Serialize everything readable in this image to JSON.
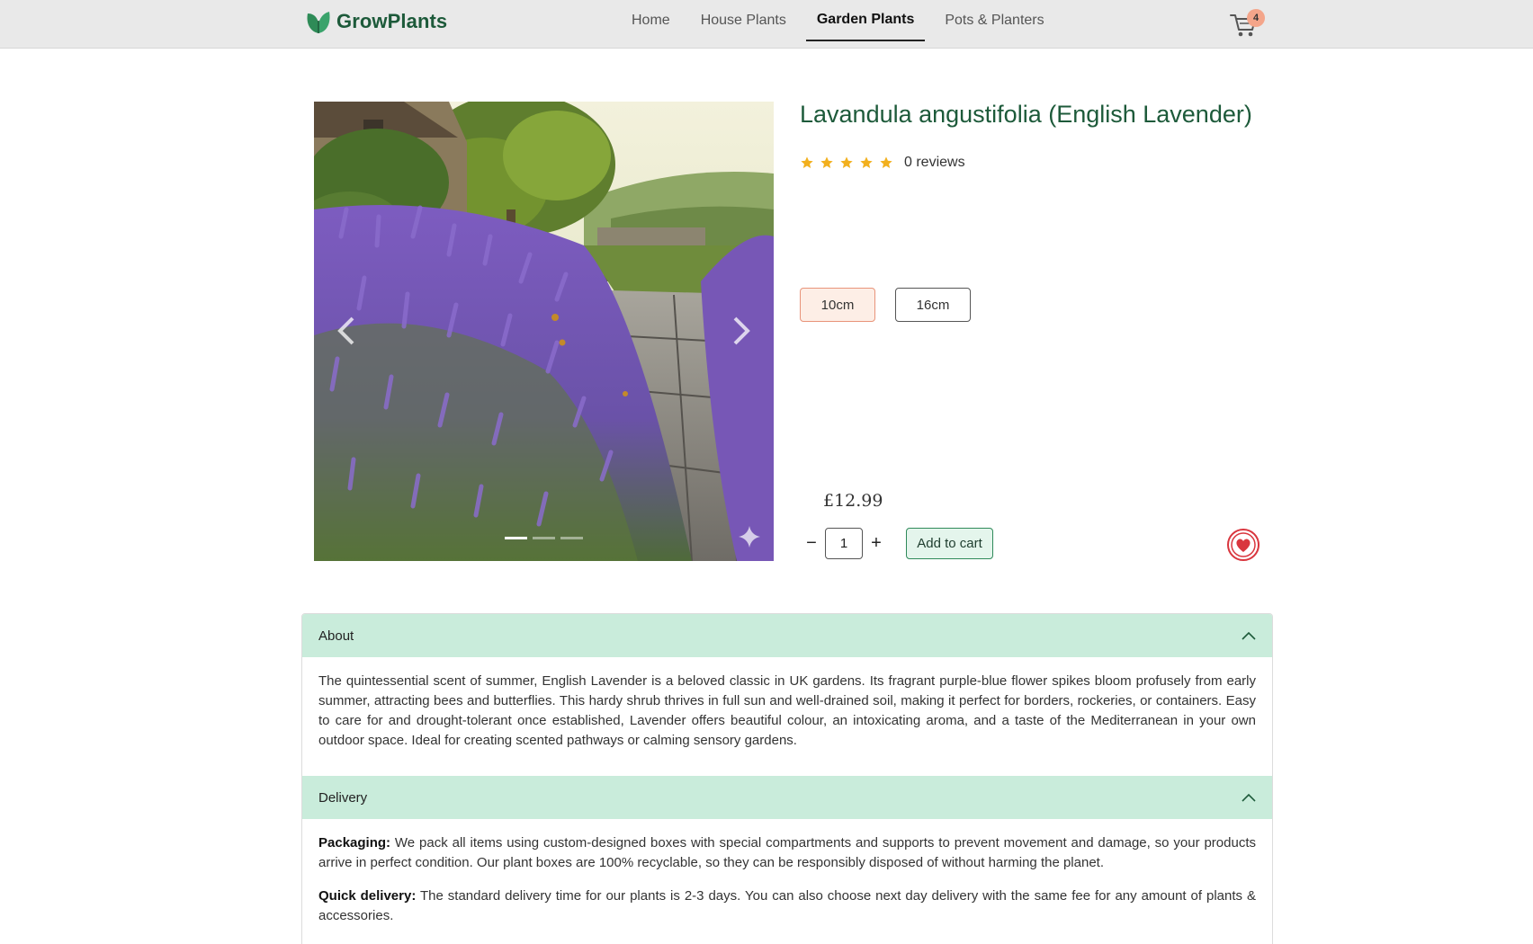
{
  "brand": {
    "name": "GrowPlants"
  },
  "nav": {
    "items": [
      {
        "label": "Home",
        "active": false
      },
      {
        "label": "House Plants",
        "active": false
      },
      {
        "label": "Garden Plants",
        "active": true
      },
      {
        "label": "Pots & Planters",
        "active": false
      }
    ]
  },
  "cart": {
    "count": "4"
  },
  "product": {
    "title": "Lavandula angustifolia (English Lavender)",
    "rating": 5,
    "reviews": "0 reviews",
    "sizes": [
      {
        "label": "10cm",
        "selected": true
      },
      {
        "label": "16cm",
        "selected": false
      }
    ],
    "price": "£12.99",
    "quantity": "1",
    "add_to_cart_label": "Add to cart",
    "qty_minus_label": "−",
    "qty_plus_label": "+"
  },
  "gallery": {
    "slides": 3,
    "active_slide": 1
  },
  "accordion": {
    "about": {
      "title": "About",
      "text": "The quintessential scent of summer, English Lavender is a beloved classic in UK gardens. Its fragrant purple-blue flower spikes bloom profusely from early summer, attracting bees and butterflies. This hardy shrub thrives in full sun and well-drained soil, making it perfect for borders, rockeries, or containers. Easy to care for and drought-tolerant once established, Lavender offers beautiful colour, an intoxicating aroma, and a taste of the Mediterranean in your own outdoor space. Ideal for creating scented pathways or calming sensory gardens."
    },
    "delivery": {
      "title": "Delivery",
      "packaging_label": "Packaging:",
      "packaging_text": "We pack all items using custom-designed boxes with special compartments and supports to prevent movement and damage, so your products arrive in perfect condition. Our plant boxes are 100% recyclable, so they can be responsibly disposed of without harming the planet.",
      "quick_label": "Quick delivery:",
      "quick_text": "The standard delivery time for our plants is 2-3 days. You can also choose next day delivery with the same fee for any amount of plants & accessories."
    }
  },
  "colors": {
    "brand_green": "#1d5a3a",
    "accordion_header": "#c9ecdb",
    "star": "#f2b01e",
    "cart_badge": "#f4a58a",
    "size_selected_bg": "#fdeee6",
    "wishlist_red": "#d9363e"
  },
  "icons": {
    "logo": "leaf-icon",
    "cart": "shopping-cart-icon",
    "prev": "chevron-left-icon",
    "next": "chevron-right-icon",
    "wishlist": "heart-icon",
    "accordion": "chevron-up-icon",
    "star": "star-icon"
  }
}
